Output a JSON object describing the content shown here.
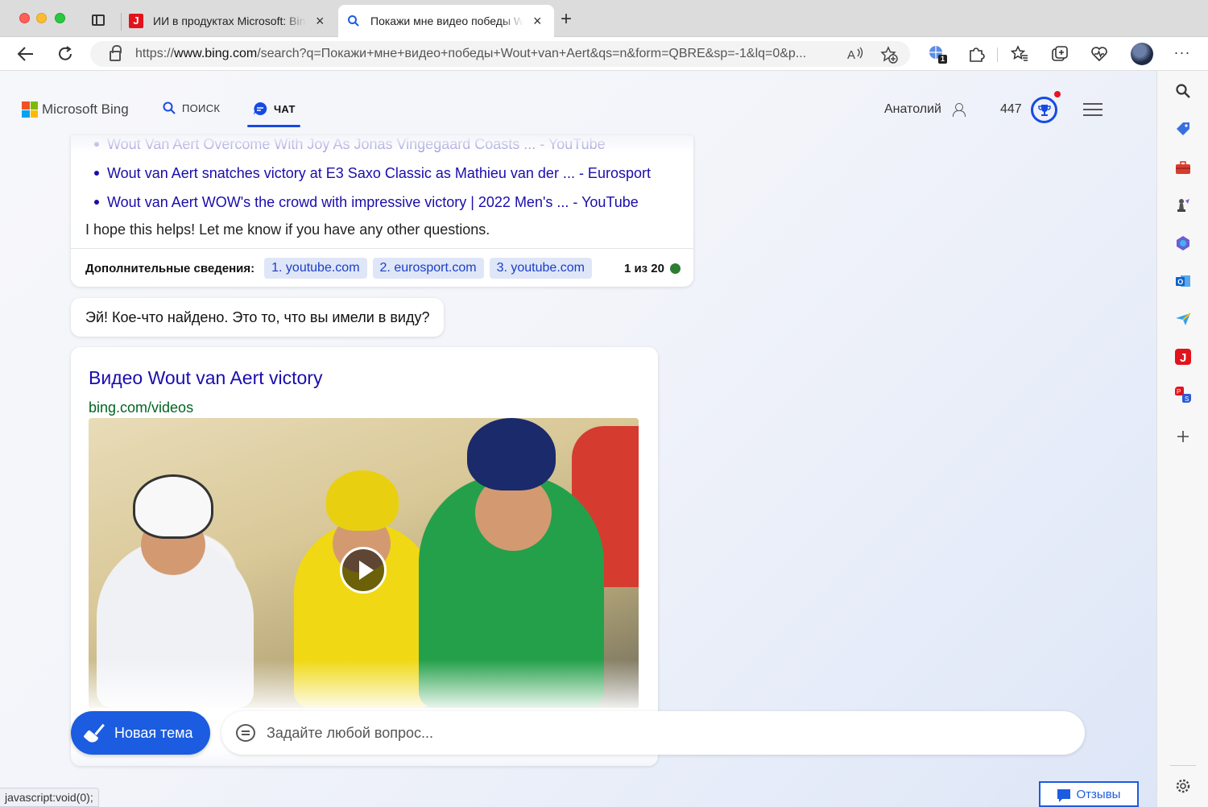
{
  "browser": {
    "tabs": [
      {
        "title": "ИИ в продуктах Microsoft: Bing",
        "active": false
      },
      {
        "title": "Покажи мне видео победы Wout",
        "active": true
      }
    ],
    "address": {
      "scheme": "https://",
      "host": "www.bing.com",
      "path": "/search?q=Покажи+мне+видео+победы+Wout+van+Aert&qs=n&form=QBRE&sp=-1&lq=0&p..."
    },
    "extension_badge": "1",
    "status_bar": "javascript:void(0);"
  },
  "header": {
    "logo": "Microsoft Bing",
    "nav": [
      {
        "label": "ПОИСК",
        "icon": "search-icon",
        "active": false
      },
      {
        "label": "ЧАТ",
        "icon": "chat-icon",
        "active": true
      }
    ],
    "user_name": "Анатолий",
    "points": "447"
  },
  "chat": {
    "previous_answer": {
      "links": [
        "Wout Van Aert Overcome With Joy As Jonas Vingegaard Coasts ... - YouTube",
        "Wout van Aert snatches victory at E3 Saxo Classic as Mathieu van der ... - Eurosport",
        "Wout van Aert WOW's the crowd with impressive victory | 2022 Men's ... - YouTube"
      ],
      "closing": "I hope this helps! Let me know if you have any other questions.",
      "learn_more_label": "Дополнительные сведения:",
      "sources": [
        "1. youtube.com",
        "2. eurosport.com",
        "3. youtube.com"
      ],
      "turn_counter": "1 из 20"
    },
    "bot_message": "Эй! Кое-что найдено. Это то, что вы имели в виду?",
    "video_card": {
      "title": "Видео Wout van Aert victory",
      "source": "bing.com/videos"
    }
  },
  "composer": {
    "new_topic_label": "Новая тема",
    "placeholder": "Задайте любой вопрос..."
  },
  "feedback_label": "Отзывы",
  "colors": {
    "accent": "#174ae4",
    "link": "#1a0dab",
    "source_green": "#006621",
    "button_blue": "#1b5ce0"
  }
}
